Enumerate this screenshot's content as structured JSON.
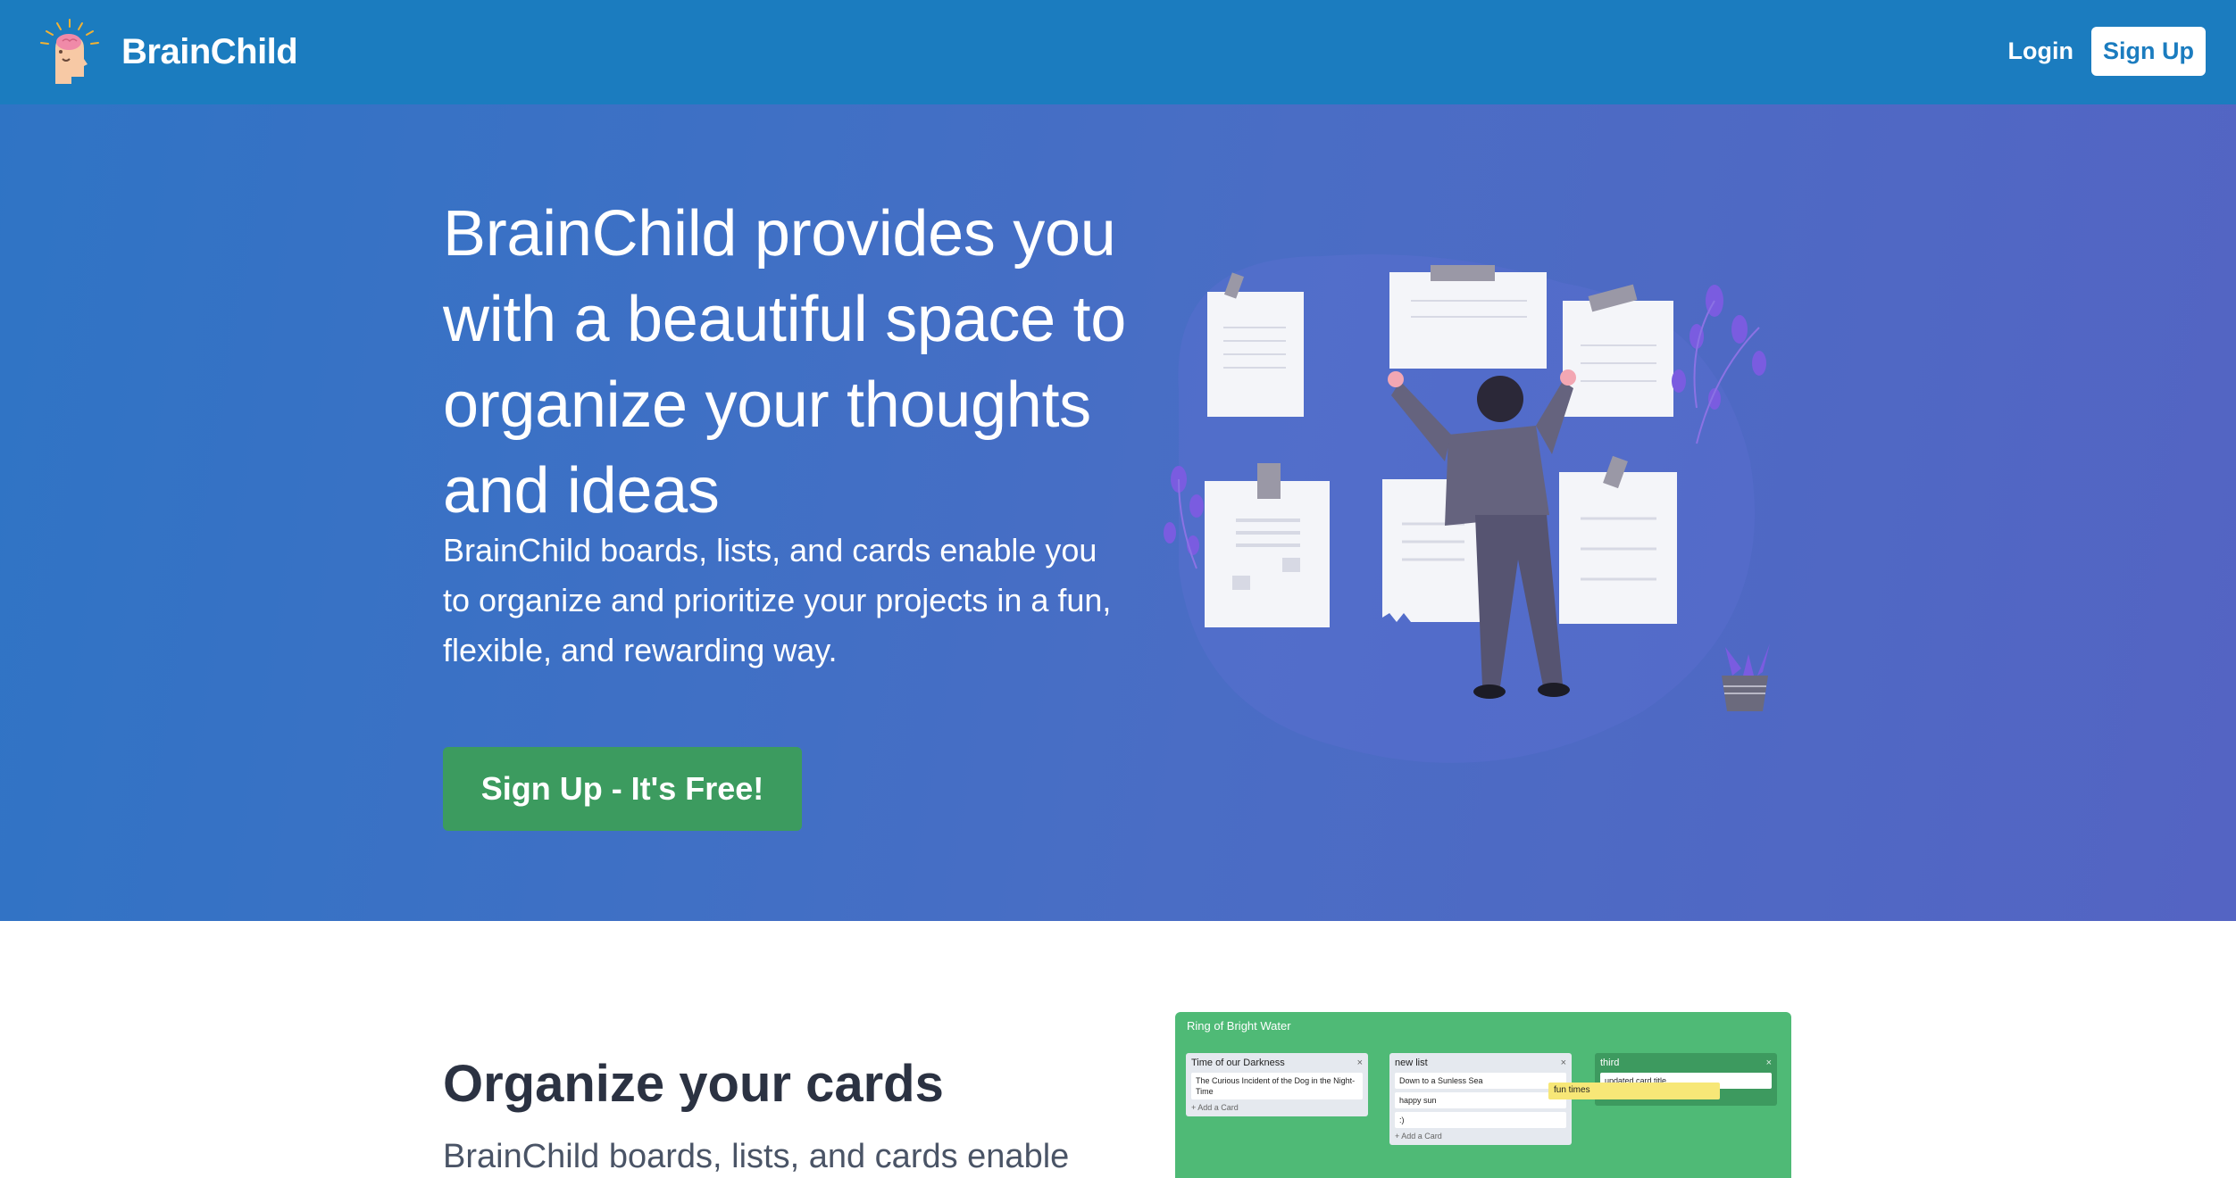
{
  "navbar": {
    "brand_name": "BrainChild",
    "login_label": "Login",
    "signup_label": "Sign Up",
    "bg_color": "#1b7cbf"
  },
  "hero": {
    "title": "BrainChild provides you with a beautiful space to organize your thoughts and ideas",
    "subtitle": "BrainChild boards, lists, and cards enable you to organize and prioritize your projects in a fun, flexible, and rewarding way.",
    "cta_label": "Sign Up - It's Free!",
    "cta_color": "#3c9b5f"
  },
  "section_two": {
    "title": "Organize your cards",
    "subtitle": "BrainChild boards, lists, and cards enable"
  },
  "board_preview": {
    "title": "Ring of Bright Water",
    "lists": [
      {
        "title": "Time of our Darkness",
        "close": "×",
        "cards": [
          "The Curious Incident of the Dog in the Night-Time"
        ],
        "add_label": "+ Add a Card"
      },
      {
        "title": "new list",
        "close": "×",
        "cards": [
          "Down to a Sunless Sea",
          "happy sun",
          ":)"
        ],
        "add_label": "+ Add a Card"
      },
      {
        "title": "third",
        "close": "×",
        "cards": [
          "updated card title"
        ],
        "add_label": "+ Add a Card"
      }
    ],
    "drag_card": "fun times",
    "color": "#4fba76"
  }
}
